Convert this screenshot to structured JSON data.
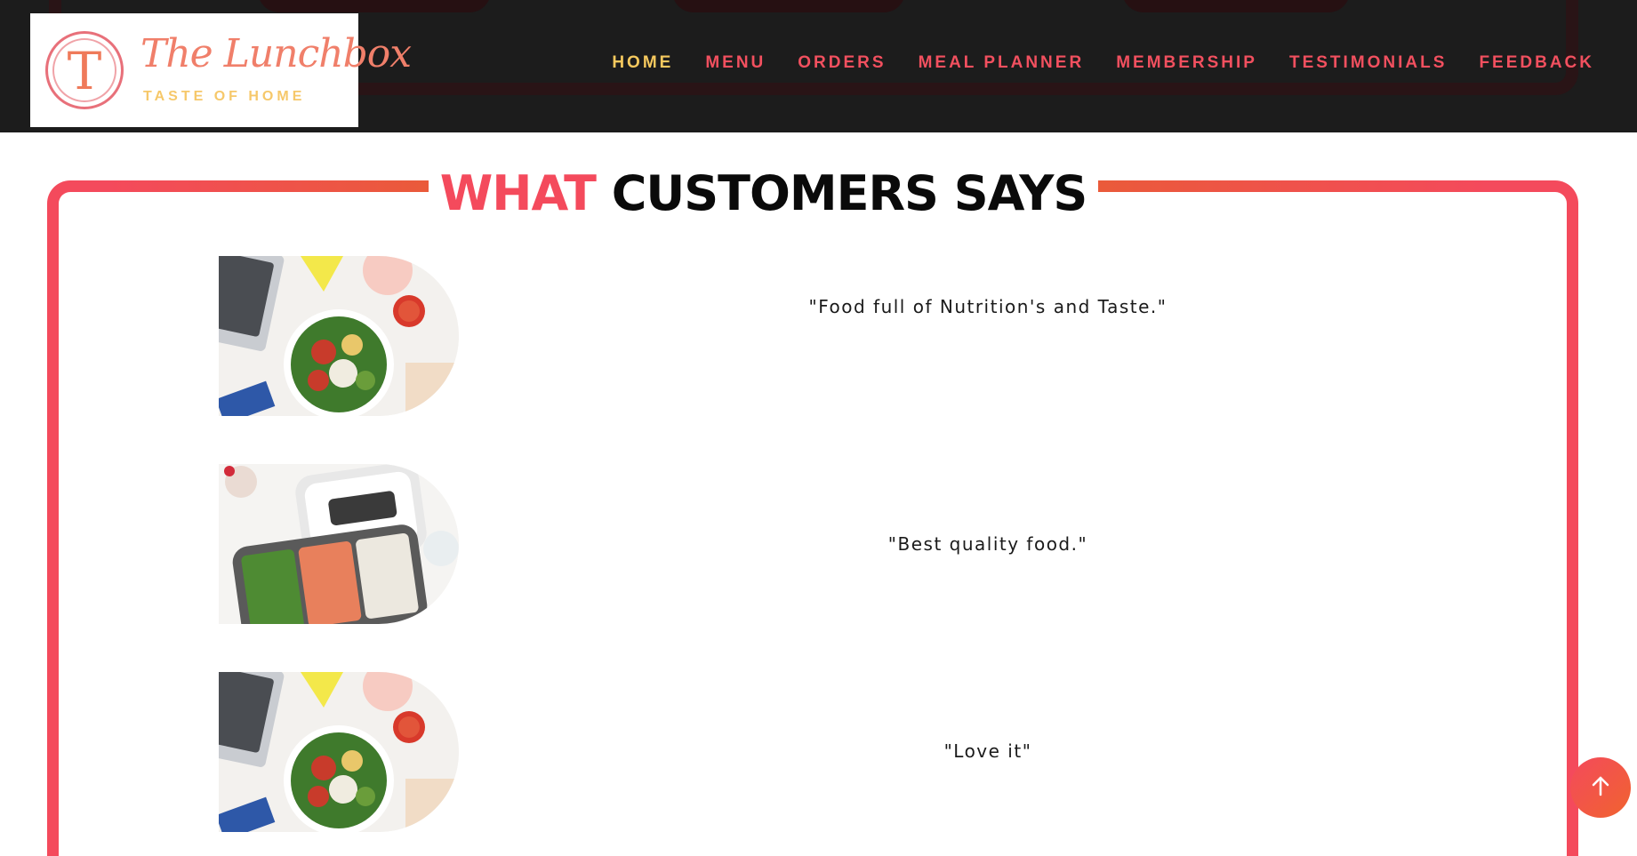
{
  "brand": {
    "logo_letter": "T",
    "name": "The Lunchbox",
    "tagline": "TASTE OF HOME"
  },
  "nav": {
    "items": [
      {
        "label": "HOME",
        "active": true
      },
      {
        "label": "MENU",
        "active": false
      },
      {
        "label": "ORDERS",
        "active": false
      },
      {
        "label": "MEAL PLANNER",
        "active": false
      },
      {
        "label": "MEMBERSHIP",
        "active": false
      },
      {
        "label": "TESTIMONIALS",
        "active": false
      },
      {
        "label": "FEEDBACK",
        "active": false
      }
    ]
  },
  "section": {
    "title_accent": "WHAT",
    "title_rest": "CUSTOMERS SAYS"
  },
  "testimonials": [
    {
      "quote": "\"Food full of Nutrition's and Taste.\"",
      "image": "salad-bowl-image"
    },
    {
      "quote": "\"Best quality food.\"",
      "image": "lunchbox-image"
    },
    {
      "quote": "\"Love it\"",
      "image": "salad-bowl-image"
    }
  ],
  "colors": {
    "accent": "#f44a5c",
    "active_nav": "#f6c95e",
    "header_bg": "#1c1c1c",
    "gradient_end": "#f0632f"
  },
  "icons": {
    "scroll_top": "arrow-up-icon"
  }
}
